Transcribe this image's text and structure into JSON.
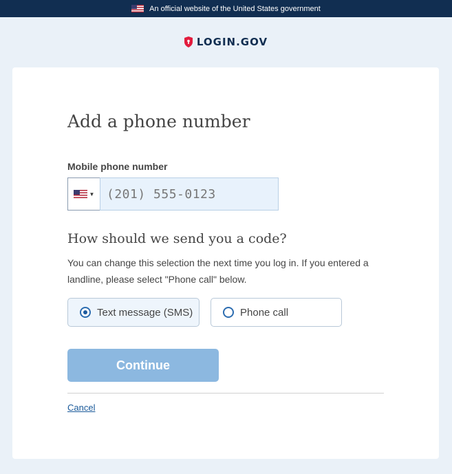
{
  "banner": {
    "text": "An official website of the United States government",
    "icon": "us-flag-icon"
  },
  "brand": {
    "logo_text": "LOGIN.GOV",
    "logo_icon": "shield-lock-icon"
  },
  "page": {
    "title": "Add a phone number"
  },
  "phone_field": {
    "label": "Mobile phone number",
    "placeholder": "(201) 555-0123",
    "country_icon": "us-flag-icon"
  },
  "delivery": {
    "heading": "How should we send you a code?",
    "help": "You can change this selection the next time you log in. If you entered a landline, please select \"Phone call\" below.",
    "options": [
      {
        "label": "Text message (SMS)",
        "checked": true
      },
      {
        "label": "Phone call",
        "checked": false
      }
    ]
  },
  "actions": {
    "continue_label": "Continue",
    "cancel_label": "Cancel"
  },
  "colors": {
    "banner_bg": "#112e51",
    "page_bg": "#eaf1f8",
    "button_disabled": "#8cb8e0",
    "link": "#1a5a9a"
  }
}
